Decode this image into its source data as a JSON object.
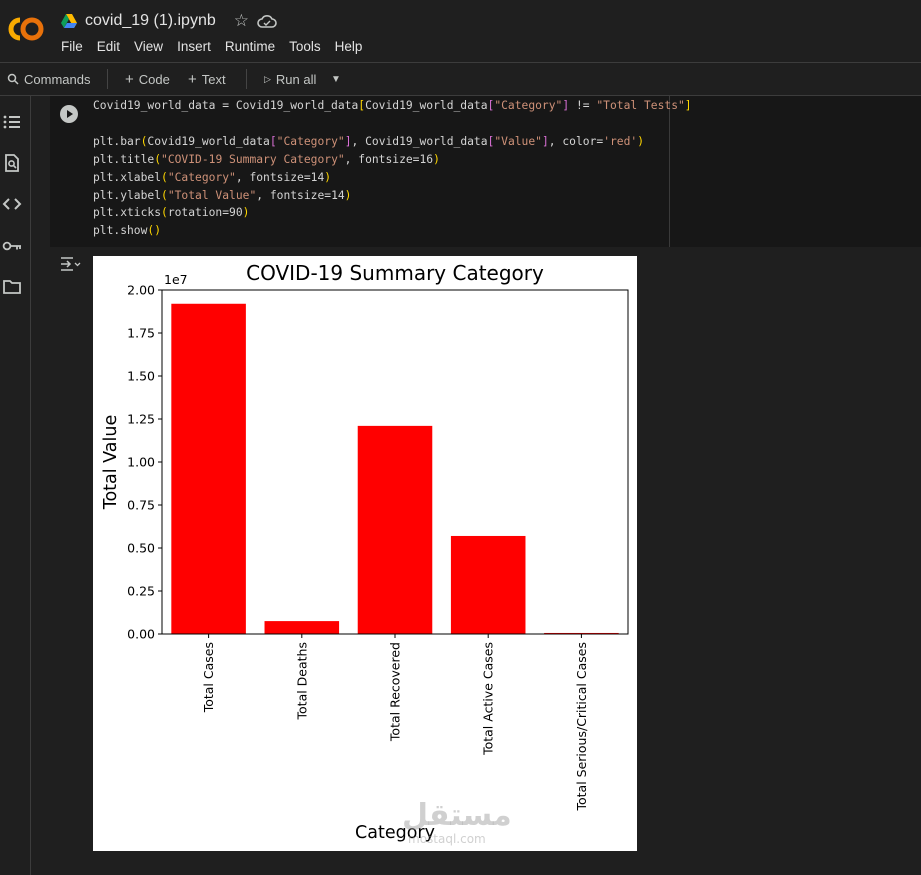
{
  "header": {
    "logo_text": "CO",
    "notebook_title": "covid_19 (1).ipynb",
    "menu": [
      "File",
      "Edit",
      "View",
      "Insert",
      "Runtime",
      "Tools",
      "Help"
    ]
  },
  "toolbar": {
    "commands": "Commands",
    "code": "Code",
    "text": "Text",
    "run_all": "Run all"
  },
  "rail": [
    "toc-icon",
    "find-icon",
    "code-snippets-icon",
    "secrets-key-icon",
    "files-folder-icon"
  ],
  "cell": {
    "lines": [
      "Covid19_world_data = Covid19_world_data[Covid19_world_data[\"Category\"] != \"Total Tests\"]",
      "",
      "plt.bar(Covid19_world_data[\"Category\"], Covid19_world_data[\"Value\"], color='red')",
      "plt.title(\"COVID-19 Summary Category\", fontsize=16)",
      "plt.xlabel(\"Category\", fontsize=14)",
      "plt.ylabel(\"Total Value\", fontsize=14)",
      "plt.xticks(rotation=90)",
      "plt.show()"
    ]
  },
  "chart_data": {
    "type": "bar",
    "title": "COVID-19 Summary Category",
    "xlabel": "Category",
    "ylabel": "Total Value",
    "offset_label": "1e7",
    "categories": [
      "Total Cases",
      "Total Deaths",
      "Total Recovered",
      "Total Active Cases",
      "Total Serious/Critical Cases"
    ],
    "values": [
      1.92,
      0.075,
      1.21,
      0.57,
      0.006
    ],
    "yticks": [
      "0.00",
      "0.25",
      "0.50",
      "0.75",
      "1.00",
      "1.25",
      "1.50",
      "1.75",
      "2.00"
    ],
    "ylim": [
      0,
      2.0
    ],
    "color": "#ff0000",
    "grid": false
  },
  "watermark": {
    "arabic": "مستقل",
    "latin": "mostaql.com"
  }
}
